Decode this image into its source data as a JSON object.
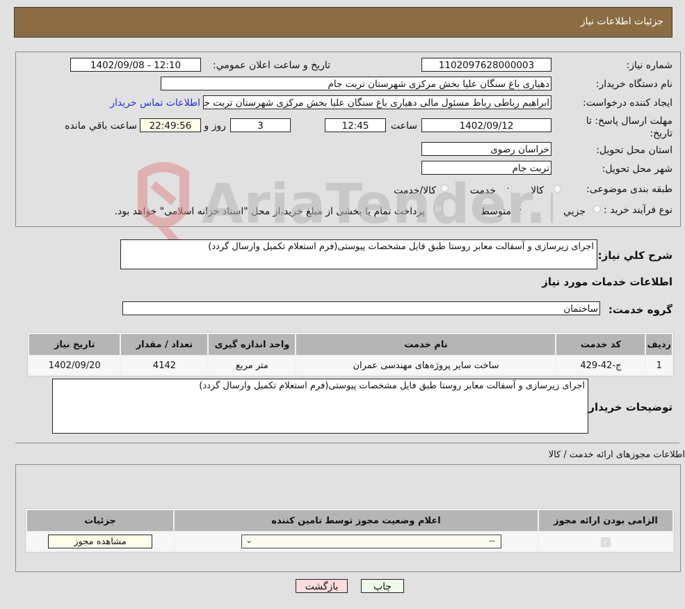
{
  "header": {
    "title": "جزئیات اطلاعات نیاز"
  },
  "form": {
    "need_number": {
      "label": "شماره نیاز:",
      "value": "1102097628000003"
    },
    "announce_datetime": {
      "label": "تاریخ و ساعت اعلان عمومي:",
      "value": "1402/09/08 - 12:10"
    },
    "buyer_org": {
      "label": "نام دستگاه خریدار:",
      "value": "دهیاری باغ سنگان علیا بخش مرکزی شهرستان تربت جام"
    },
    "requester": {
      "label": "ایجاد کننده درخواست:",
      "value": "ابراهیم رباطی رباط مسئول مالی دهیاری باغ سنگان علیا بخش مرکزی شهرستان تربت جام"
    },
    "contact_link": "اطلاعات تماس خریدار",
    "deadline": {
      "label": "مهلت ارسال پاسخ: تا تاریخ:",
      "date": "1402/09/12",
      "time_label": "ساعت",
      "time": "12:45",
      "days": "3",
      "days_label": "روز و",
      "remaining": "22:49:56",
      "remaining_label": "ساعت باقي مانده"
    },
    "province": {
      "label": "استان محل تحویل:",
      "value": "خراسان رضوی"
    },
    "city": {
      "label": "شهر محل تحویل:",
      "value": "تربت جام"
    },
    "category": {
      "label": "طبقه بندی موضوعی:",
      "options": [
        "کالا",
        "خدمت",
        "کالا/خدمت"
      ],
      "selected": "خدمت"
    },
    "purchase_type": {
      "label": "نوع فرآیند خرید :",
      "options": [
        "جزيي",
        "متوسط"
      ],
      "selected": "متوسط",
      "treasury_note": "پرداخت تمام یا بخشی از مبلغ خرید،از محل \"اسناد خزانه اسلامی\" خواهد بود.",
      "treasury_checked": false
    }
  },
  "summary": {
    "label": "شرح کلي نیاز:",
    "value": "اجرای زیرسازی و آسفالت معابر روستا طبق فایل مشخصات پیوستی(فرم استعلام تکمیل وارسال گردد)"
  },
  "services": {
    "section_title": "اطلاعات خدمات مورد نیاز",
    "group_label": "گروه خدمت:",
    "group_value": "ساختمان",
    "columns": [
      "ردیف",
      "کد خدمت",
      "نام خدمت",
      "واحد اندازه گیری",
      "تعداد / مقدار",
      "تاریخ نیاز"
    ],
    "rows": [
      [
        "1",
        "ج-42-429",
        "ساخت سایر پروژه‌های مهندسی عمران",
        "متر مربع",
        "4142",
        "1402/09/20"
      ]
    ]
  },
  "buyer_notes": {
    "label": "توضیحات خریدار:",
    "value": "اجرای زیرسازی و آسفالت معابر روستا طبق فایل مشخصات پیوستی(فرم استعلام تکمیل وارسال گردد)"
  },
  "permits": {
    "section_title": "اطلاعات مجوزهای ارائه خدمت / کالا",
    "columns": [
      "الزامی بودن ارائه مجوز",
      "اعلام وضعیت مجوز توسط تامین کننده",
      "جزئیات"
    ],
    "rows": [
      {
        "required": true,
        "status": "--",
        "details_button": "مشاهده مجوز"
      }
    ]
  },
  "actions": {
    "print": "چاپ",
    "back": "بازگشت"
  },
  "watermark": {
    "text": "AriaTender.neT"
  }
}
